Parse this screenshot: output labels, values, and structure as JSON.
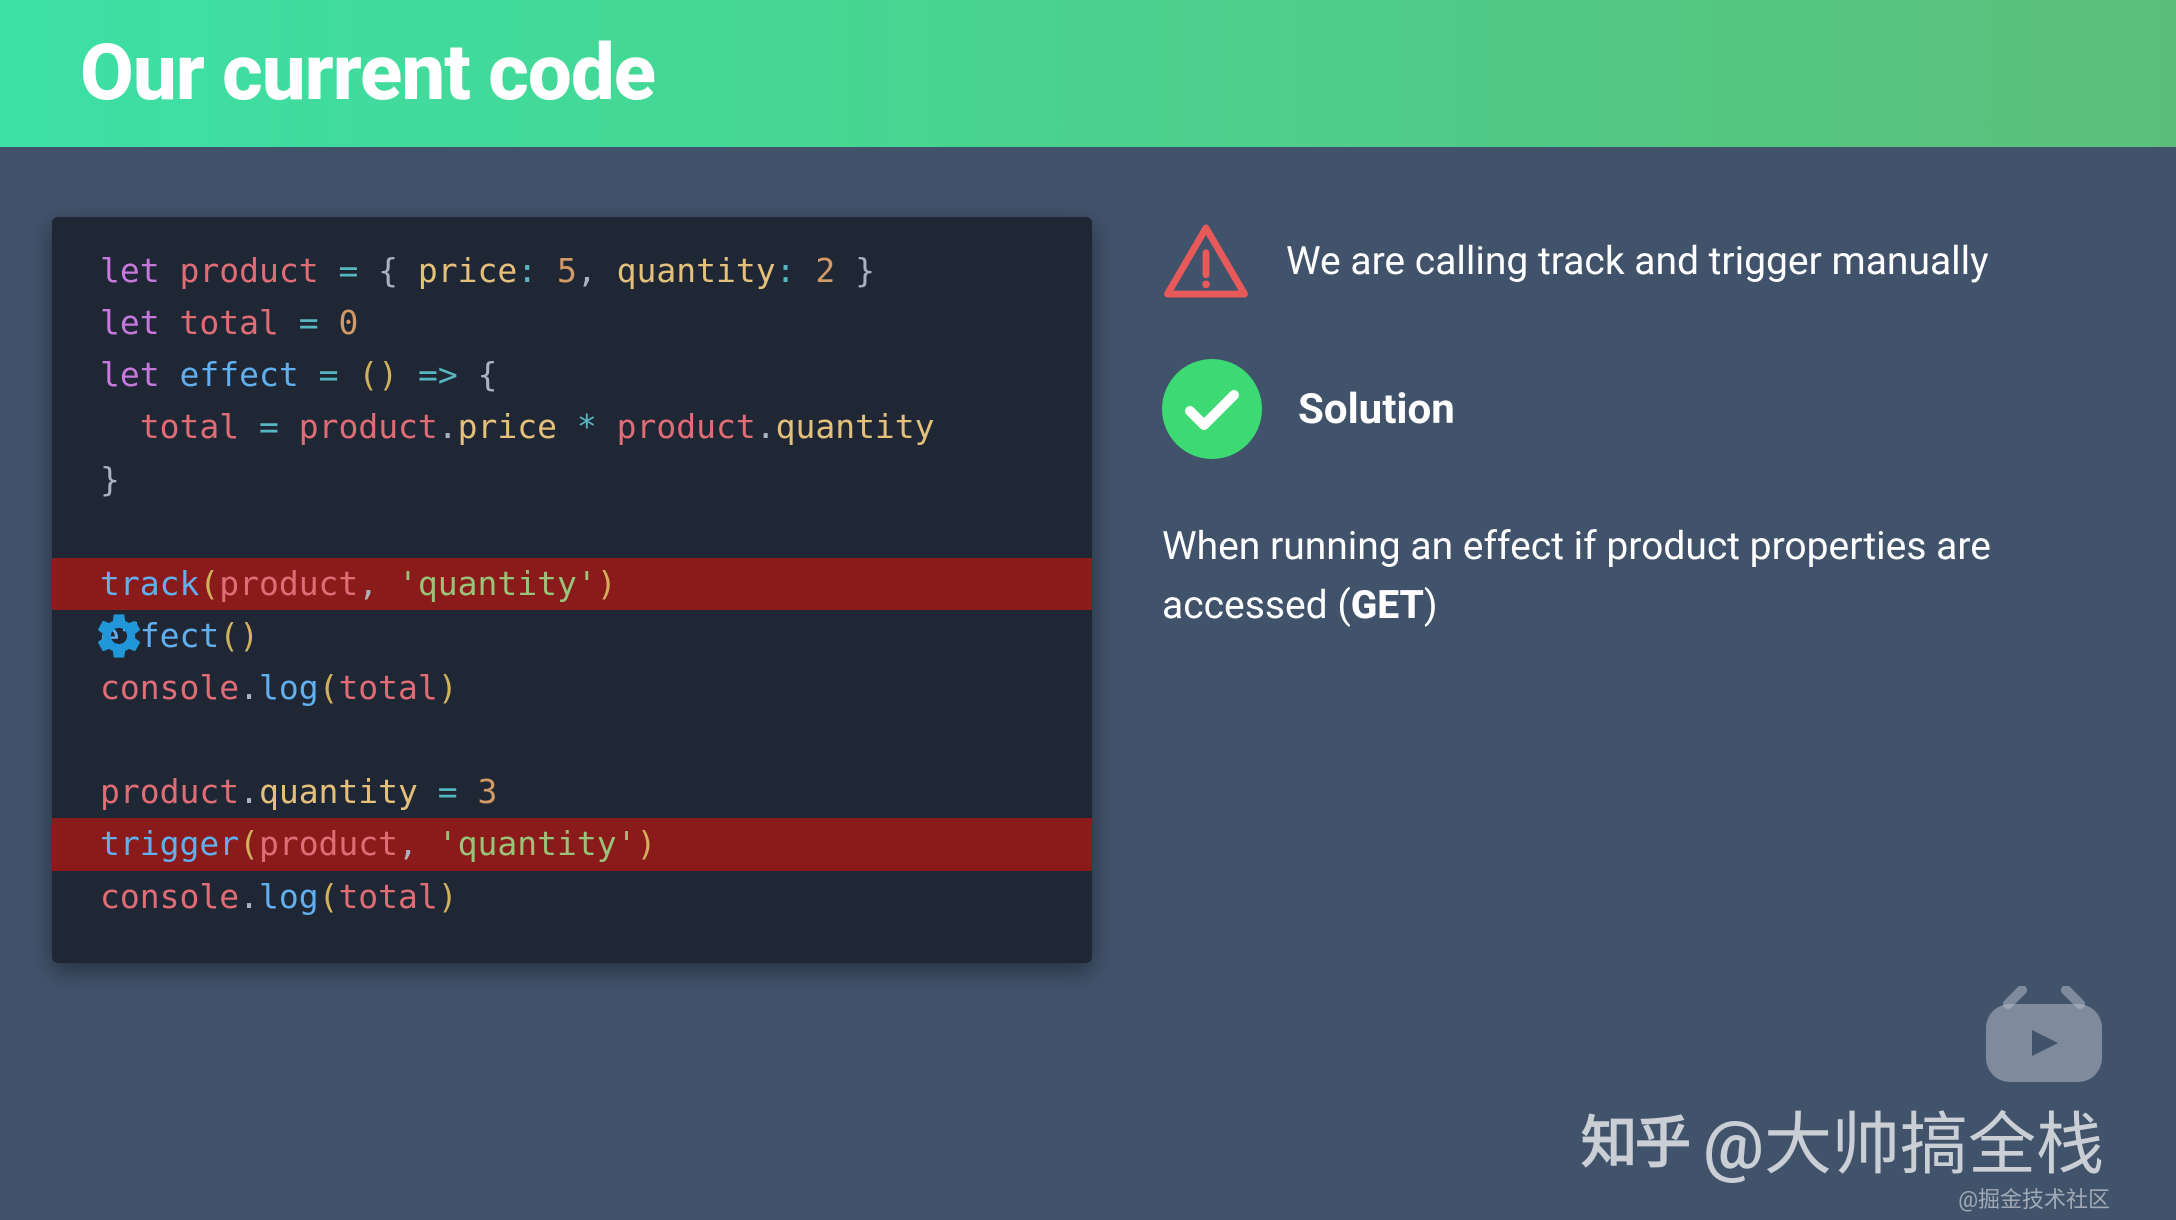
{
  "header": {
    "title": "Our current code"
  },
  "code": {
    "lines": [
      {
        "hl": false,
        "segs": [
          {
            "c": "kw",
            "t": "let"
          },
          {
            "c": "punc",
            "t": " "
          },
          {
            "c": "id",
            "t": "product"
          },
          {
            "c": "punc",
            "t": " "
          },
          {
            "c": "op",
            "t": "="
          },
          {
            "c": "punc",
            "t": " { "
          },
          {
            "c": "prop",
            "t": "price"
          },
          {
            "c": "op",
            "t": ":"
          },
          {
            "c": "punc",
            "t": " "
          },
          {
            "c": "num",
            "t": "5"
          },
          {
            "c": "punc",
            "t": ", "
          },
          {
            "c": "prop",
            "t": "quantity"
          },
          {
            "c": "op",
            "t": ":"
          },
          {
            "c": "punc",
            "t": " "
          },
          {
            "c": "num",
            "t": "2"
          },
          {
            "c": "punc",
            "t": " }"
          }
        ]
      },
      {
        "hl": false,
        "segs": [
          {
            "c": "kw",
            "t": "let"
          },
          {
            "c": "punc",
            "t": " "
          },
          {
            "c": "id",
            "t": "total"
          },
          {
            "c": "punc",
            "t": " "
          },
          {
            "c": "op",
            "t": "="
          },
          {
            "c": "punc",
            "t": " "
          },
          {
            "c": "num",
            "t": "0"
          }
        ]
      },
      {
        "hl": false,
        "segs": [
          {
            "c": "kw",
            "t": "let"
          },
          {
            "c": "punc",
            "t": " "
          },
          {
            "c": "fn",
            "t": "effect"
          },
          {
            "c": "punc",
            "t": " "
          },
          {
            "c": "op",
            "t": "="
          },
          {
            "c": "punc",
            "t": " "
          },
          {
            "c": "paren",
            "t": "()"
          },
          {
            "c": "punc",
            "t": " "
          },
          {
            "c": "op",
            "t": "=>"
          },
          {
            "c": "punc",
            "t": " {"
          }
        ]
      },
      {
        "hl": false,
        "segs": [
          {
            "c": "punc",
            "t": "  "
          },
          {
            "c": "id",
            "t": "total"
          },
          {
            "c": "punc",
            "t": " "
          },
          {
            "c": "op",
            "t": "="
          },
          {
            "c": "punc",
            "t": " "
          },
          {
            "c": "id",
            "t": "product"
          },
          {
            "c": "punc",
            "t": "."
          },
          {
            "c": "prop",
            "t": "price"
          },
          {
            "c": "punc",
            "t": " "
          },
          {
            "c": "op",
            "t": "*"
          },
          {
            "c": "punc",
            "t": " "
          },
          {
            "c": "id",
            "t": "product"
          },
          {
            "c": "punc",
            "t": "."
          },
          {
            "c": "prop",
            "t": "quantity"
          }
        ]
      },
      {
        "hl": false,
        "segs": [
          {
            "c": "punc",
            "t": "}"
          }
        ]
      },
      {
        "hl": false,
        "segs": [
          {
            "c": "punc",
            "t": ""
          }
        ]
      },
      {
        "hl": true,
        "segs": [
          {
            "c": "fn",
            "t": "track"
          },
          {
            "c": "paren",
            "t": "("
          },
          {
            "c": "id",
            "t": "product"
          },
          {
            "c": "punc",
            "t": ", "
          },
          {
            "c": "str",
            "t": "'quantity'"
          },
          {
            "c": "paren",
            "t": ")"
          }
        ]
      },
      {
        "hl": false,
        "segs": [
          {
            "c": "fn",
            "t": "effect"
          },
          {
            "c": "paren",
            "t": "()"
          }
        ]
      },
      {
        "hl": false,
        "segs": [
          {
            "c": "id",
            "t": "console"
          },
          {
            "c": "punc",
            "t": "."
          },
          {
            "c": "fn",
            "t": "log"
          },
          {
            "c": "paren",
            "t": "("
          },
          {
            "c": "id",
            "t": "total"
          },
          {
            "c": "paren",
            "t": ")"
          }
        ]
      },
      {
        "hl": false,
        "segs": [
          {
            "c": "punc",
            "t": ""
          }
        ]
      },
      {
        "hl": false,
        "segs": [
          {
            "c": "id",
            "t": "product"
          },
          {
            "c": "punc",
            "t": "."
          },
          {
            "c": "prop",
            "t": "quantity"
          },
          {
            "c": "punc",
            "t": " "
          },
          {
            "c": "op",
            "t": "="
          },
          {
            "c": "punc",
            "t": " "
          },
          {
            "c": "num",
            "t": "3"
          }
        ]
      },
      {
        "hl": true,
        "segs": [
          {
            "c": "fn",
            "t": "trigger"
          },
          {
            "c": "paren",
            "t": "("
          },
          {
            "c": "id",
            "t": "product"
          },
          {
            "c": "punc",
            "t": ", "
          },
          {
            "c": "str",
            "t": "'quantity'"
          },
          {
            "c": "paren",
            "t": ")"
          }
        ]
      },
      {
        "hl": false,
        "segs": [
          {
            "c": "id",
            "t": "console"
          },
          {
            "c": "punc",
            "t": "."
          },
          {
            "c": "fn",
            "t": "log"
          },
          {
            "c": "paren",
            "t": "("
          },
          {
            "c": "id",
            "t": "total"
          },
          {
            "c": "paren",
            "t": ")"
          }
        ]
      }
    ]
  },
  "notes": {
    "warning": "We are calling track and trigger manually",
    "solution_label": "Solution",
    "solution_text_pre": "When running an effect if product properties are accessed (",
    "solution_text_bold": "GET",
    "solution_text_post": ")"
  },
  "watermark": {
    "logo": "知乎",
    "text": "@大帅搞全栈",
    "sub": "@掘金技术社区"
  }
}
